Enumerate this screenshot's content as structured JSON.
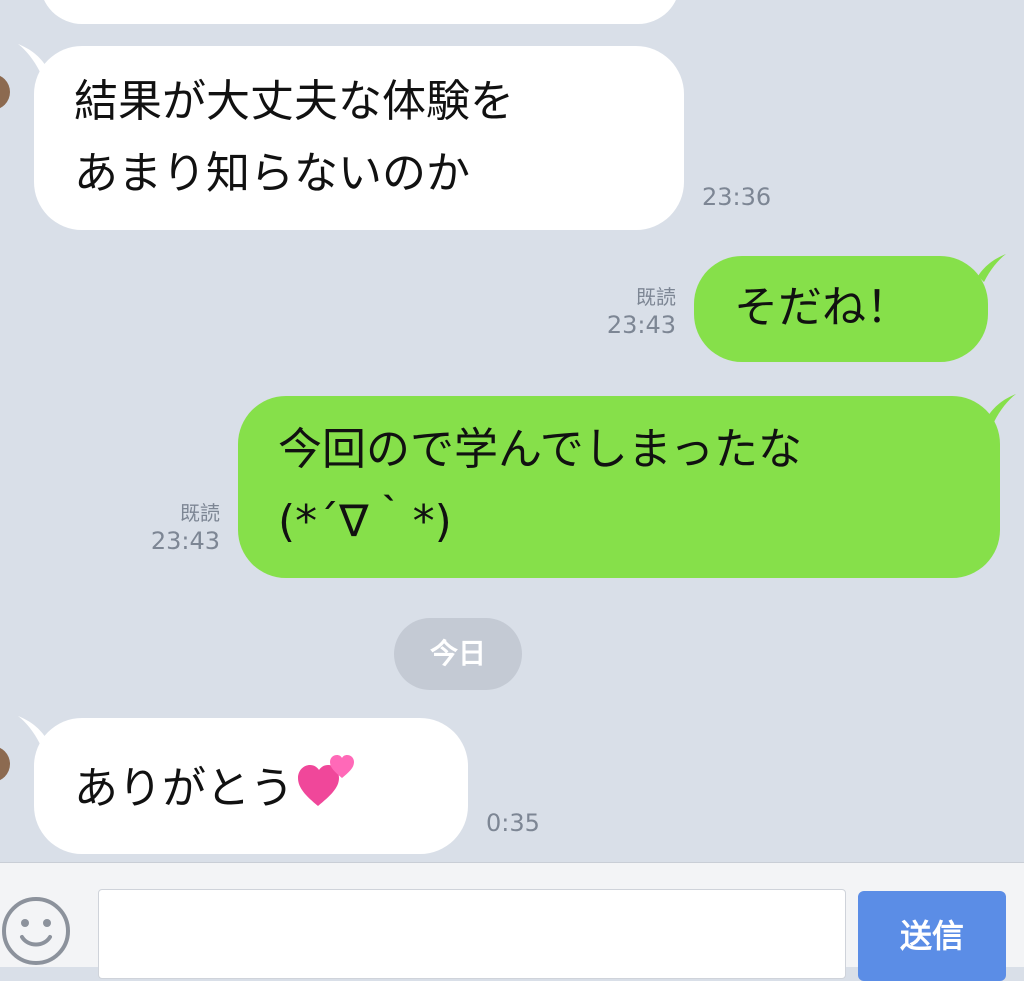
{
  "messages": [
    {
      "side": "in",
      "lines": [
        "結果が大丈夫な体験を",
        "あまり知らないのか"
      ],
      "time": "23:36"
    },
    {
      "side": "out",
      "lines": [
        "そだね！"
      ],
      "read": "既読",
      "time": "23:43"
    },
    {
      "side": "out",
      "lines": [
        "今回ので学んでしまったな",
        "(*´∇｀*)"
      ],
      "read": "既読",
      "time": "23:43"
    },
    {
      "side": "in",
      "lines": [
        "ありがとう"
      ],
      "emoji": "two-hearts-icon",
      "time": "0:35"
    }
  ],
  "date_separator": "今日",
  "input": {
    "value": "",
    "placeholder": ""
  },
  "send_button": "送信",
  "colors": {
    "background": "#d9dfe8",
    "incoming_bubble": "#ffffff",
    "outgoing_bubble": "#86e04a",
    "send_button": "#5b8de6",
    "meta_text": "#7d8694"
  }
}
